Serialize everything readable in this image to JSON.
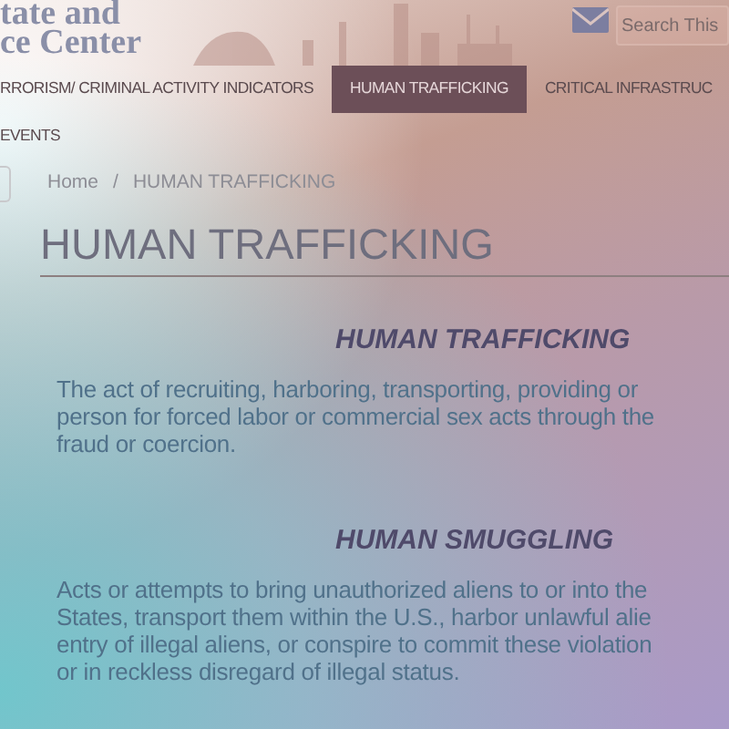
{
  "header": {
    "site_name_lines": [
      "tate and",
      "ce Center"
    ],
    "search": {
      "placeholder": "Search This"
    }
  },
  "nav": [
    {
      "label": "RRORISM/ CRIMINAL ACTIVITY INDICATORS",
      "selected": false
    },
    {
      "label": "HUMAN TRAFFICKING",
      "selected": true
    },
    {
      "label": "CRITICAL INFRASTRUC",
      "selected": false
    },
    {
      "label": "EVENTS",
      "selected": false
    }
  ],
  "breadcrumb": {
    "separator": "/",
    "items": [
      "Home",
      "HUMAN TRAFFICKING"
    ]
  },
  "page_title": "HUMAN TRAFFICKING",
  "sections": [
    {
      "heading": "HUMAN TRAFFICKING",
      "lines": [
        "The act of recruiting, harboring, transporting, providing or",
        "person for forced labor or commercial sex acts through the",
        "fraud or coercion."
      ]
    },
    {
      "heading": "HUMAN SMUGGLING",
      "lines": [
        "Acts or attempts to bring unauthorized aliens to or into the",
        "States, transport them within the U.S., harbor unlawful alie",
        "entry of illegal aliens, or conspire to commit these violation",
        "or in reckless disregard of illegal status."
      ]
    }
  ]
}
